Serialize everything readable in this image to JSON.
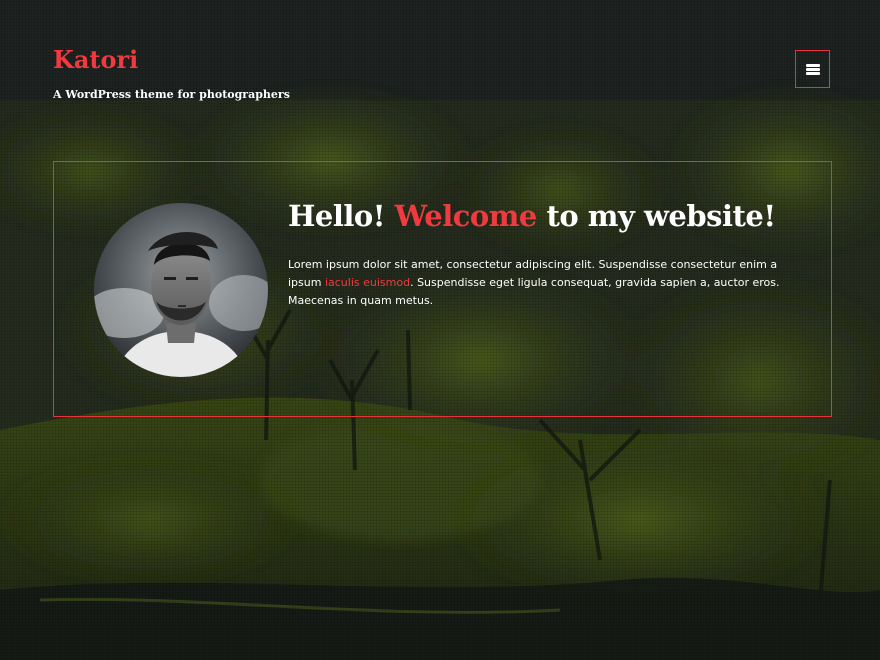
{
  "site": {
    "title": "Katori",
    "description": "A WordPress theme for photographers"
  },
  "menu": {
    "icon": "hamburger-menu-icon"
  },
  "welcome": {
    "heading_start": "Hello! ",
    "heading_accent": "Welcome",
    "heading_end": " to my website!",
    "text_start": "Lorem ipsum dolor sit amet, consectetur adipiscing elit. Suspendisse consectetur enim a ipsum ",
    "text_link": "iaculis euismod",
    "text_end": ". Suspendisse eget ligula consequat, gravida sapien a, auctor eros. Maecenas in quam metus."
  },
  "colors": {
    "accent": "#ef3b40",
    "text": "#ffffff",
    "background": "#1d2221"
  }
}
